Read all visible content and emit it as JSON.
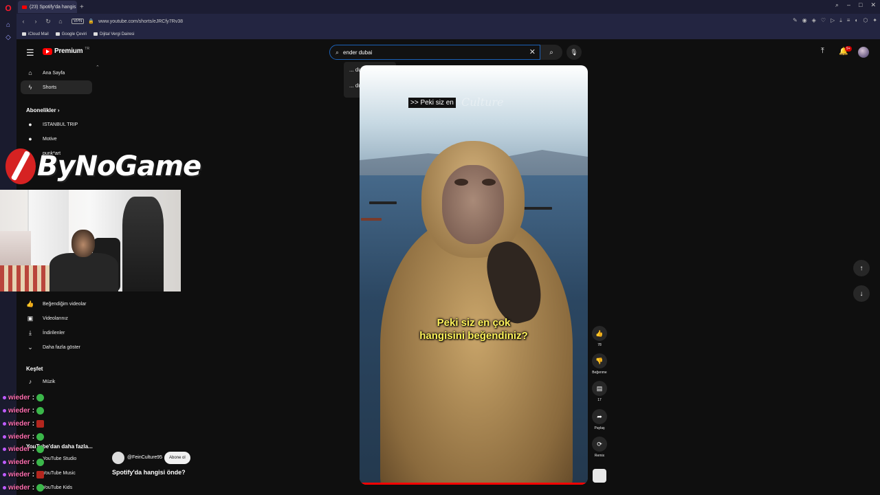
{
  "browser": {
    "tab_title": "(23) Spotify'da hangis",
    "url": "www.youtube.com/shorts/eJRCfy7Rv38",
    "vpn_label": "VPN",
    "bookmarks": [
      {
        "label": "iCloud Mail"
      },
      {
        "label": "Google Çeviri"
      },
      {
        "label": "Dijital Vergi Dairesi"
      }
    ]
  },
  "masthead": {
    "logo_text": "Premium",
    "logo_region": "TR",
    "search_value": "ender dubai",
    "notification_count": "9+"
  },
  "search_suggestions": [
    "... dubai",
    "... duba duba"
  ],
  "sidebar": {
    "home_label": "Ana Sayfa",
    "shorts_label": "Shorts",
    "subscriptions_header": "Abonelikler",
    "subscriptions": [
      "ISTANBUL TRIP",
      "Motive",
      "punk*art"
    ],
    "liked_label": "Beğendiğim videolar",
    "your_videos_label": "Videolarınız",
    "downloads_label": "İndirilenler",
    "show_more_label": "Daha fazla göster",
    "explore_header": "Keşfet",
    "music_label": "Müzik",
    "more_from_label": "YouTube'dan daha fazla...",
    "studio_label": "YouTube Studio",
    "yt_music_label": "YouTube Music",
    "yt_kids_label": "YouTube Kids"
  },
  "video": {
    "lyric_overlay": ">> Peki siz en",
    "watermark": "Culture",
    "caption_line1": "Peki siz en çok",
    "caption_line2": "hangisini beğendiniz?",
    "progress": 0.99
  },
  "actions": {
    "like_count": "78",
    "dislike_label": "Beğenme",
    "comment_count": "17",
    "share_label": "Paylaş",
    "remix_label": "Remix"
  },
  "channel": {
    "name": "@FeinCulture95",
    "subscribe_label": "Abone ol",
    "video_title": "Spotify'da hangisi önde?"
  },
  "stream_overlay": {
    "brand": "ByNoGame",
    "chat": [
      {
        "user": "wieder",
        "emote": "green"
      },
      {
        "user": "wieder",
        "emote": "green"
      },
      {
        "user": "wieder",
        "emote": "red"
      },
      {
        "user": "wieder",
        "emote": "green"
      },
      {
        "user": "wieder",
        "emote": "green"
      },
      {
        "user": "wieder",
        "emote": "green"
      },
      {
        "user": "wieder",
        "emote": "red"
      },
      {
        "user": "wieder",
        "emote": "green"
      }
    ]
  }
}
